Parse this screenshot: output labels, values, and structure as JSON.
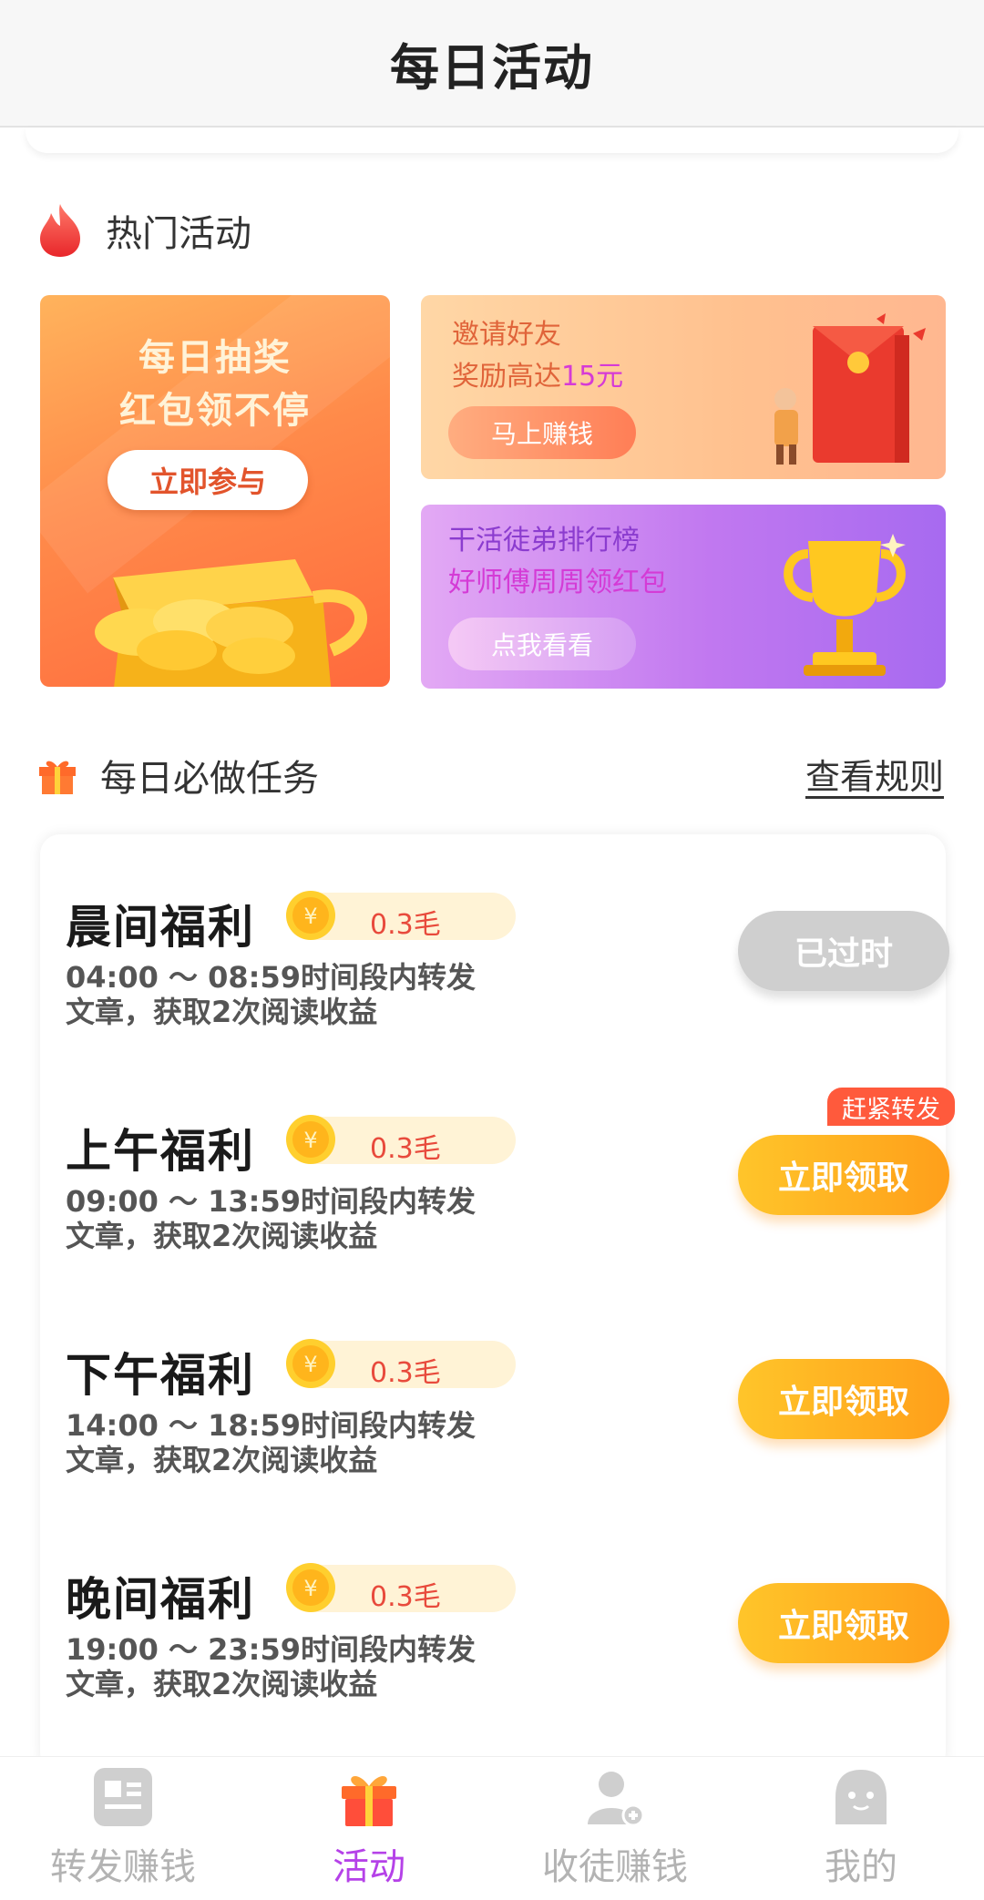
{
  "header": {
    "title": "每日活动"
  },
  "hot_section": {
    "title": "热门活动"
  },
  "promos": {
    "lottery": {
      "line1": "每日抽奖",
      "line2": "红包领不停",
      "button": "立即参与"
    },
    "invite": {
      "line1": "邀请好友",
      "line2_prefix": "奖励高达",
      "line2_highlight": "15元",
      "button": "马上赚钱"
    },
    "rank": {
      "line1": "干活徒弟排行榜",
      "line2": "好师傅周周领红包",
      "button": "点我看看"
    }
  },
  "daily_section": {
    "title": "每日必做任务",
    "rules_link": "查看规则"
  },
  "tasks": [
    {
      "name": "晨间福利",
      "reward": "0.3毛",
      "desc1": "04:00 ～ 08:59时间段内转发",
      "desc2": "文章，获取2次阅读收益",
      "button": "已过时"
    },
    {
      "name": "上午福利",
      "reward": "0.3毛",
      "desc1": "09:00 ～ 13:59时间段内转发",
      "desc2": "文章，获取2次阅读收益",
      "button": "立即领取",
      "badge": "赶紧转发"
    },
    {
      "name": "下午福利",
      "reward": "0.3毛",
      "desc1": "14:00 ～ 18:59时间段内转发",
      "desc2": "文章，获取2次阅读收益",
      "button": "立即领取"
    },
    {
      "name": "晚间福利",
      "reward": "0.3毛",
      "desc1": "19:00 ～ 23:59时间段内转发",
      "desc2": "文章，获取2次阅读收益",
      "button": "立即领取"
    }
  ],
  "nav": [
    {
      "label": "转发赚钱",
      "icon": "news-icon"
    },
    {
      "label": "活动",
      "icon": "gift-icon",
      "active": true
    },
    {
      "label": "收徒赚钱",
      "icon": "add-user-icon"
    },
    {
      "label": "我的",
      "icon": "face-icon"
    }
  ],
  "colors": {
    "accent_purple": "#b542e8",
    "button_orange": "#ffb020",
    "reward_red": "#e84a3c",
    "expired_gray": "#cfcfcf"
  }
}
